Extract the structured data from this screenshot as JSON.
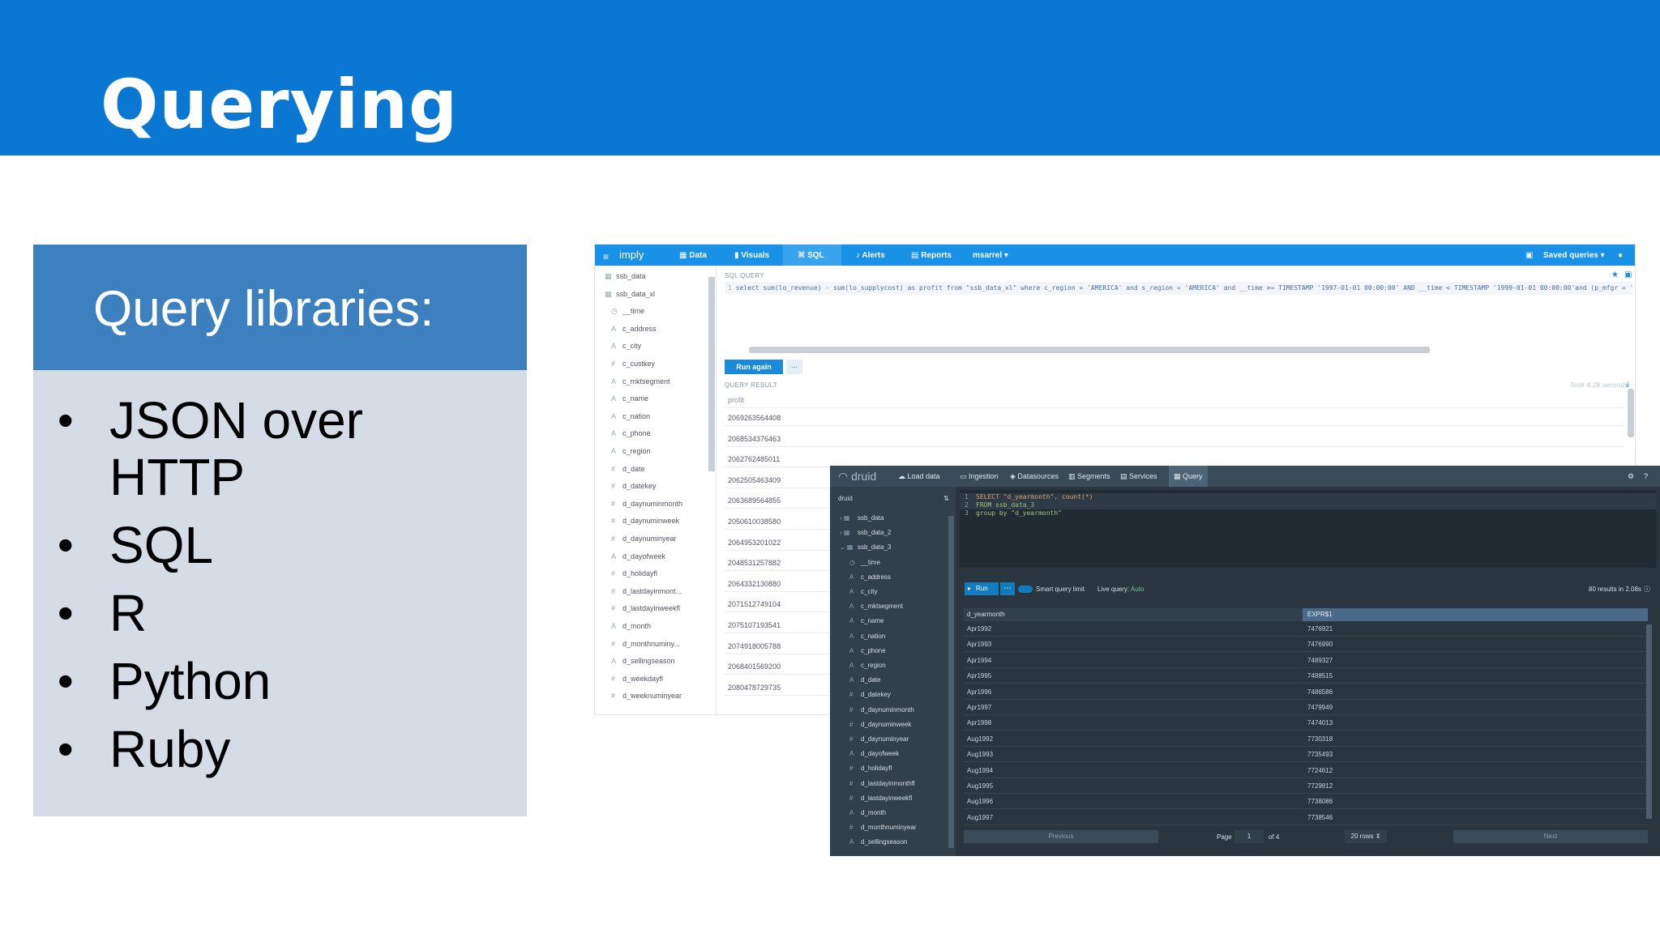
{
  "slide": {
    "title": "Querying",
    "libraries_heading": "Query libraries:",
    "libraries": [
      "JSON over HTTP",
      "SQL",
      "R",
      "Python",
      "Ruby"
    ]
  },
  "imply": {
    "brand": "imply",
    "nav": [
      "Data",
      "Visuals",
      "SQL",
      "Alerts",
      "Reports",
      "msarrel"
    ],
    "saved_queries": "Saved queries",
    "sidebar": [
      {
        "icon": "table-icon",
        "label": "ssb_data"
      },
      {
        "icon": "table-icon",
        "label": "ssb_data_xl"
      },
      {
        "icon": "clock-icon",
        "label": "__time"
      },
      {
        "icon": "string-icon",
        "label": "c_address"
      },
      {
        "icon": "string-icon",
        "label": "c_city"
      },
      {
        "icon": "number-icon",
        "label": "c_custkey"
      },
      {
        "icon": "string-icon",
        "label": "c_mktsegment"
      },
      {
        "icon": "string-icon",
        "label": "c_name"
      },
      {
        "icon": "string-icon",
        "label": "c_nation"
      },
      {
        "icon": "string-icon",
        "label": "c_phone"
      },
      {
        "icon": "string-icon",
        "label": "c_region"
      },
      {
        "icon": "number-icon",
        "label": "d_date"
      },
      {
        "icon": "number-icon",
        "label": "d_datekey"
      },
      {
        "icon": "number-icon",
        "label": "d_daynuminmonth"
      },
      {
        "icon": "number-icon",
        "label": "d_daynuminweek"
      },
      {
        "icon": "number-icon",
        "label": "d_daynuminyear"
      },
      {
        "icon": "string-icon",
        "label": "d_dayofweek"
      },
      {
        "icon": "number-icon",
        "label": "d_holidayfl"
      },
      {
        "icon": "number-icon",
        "label": "d_lastdayinmont..."
      },
      {
        "icon": "number-icon",
        "label": "d_lastdayinweekfl"
      },
      {
        "icon": "string-icon",
        "label": "d_month"
      },
      {
        "icon": "number-icon",
        "label": "d_monthnuminy..."
      },
      {
        "icon": "string-icon",
        "label": "d_sellingseason"
      },
      {
        "icon": "number-icon",
        "label": "d_weekdayfl"
      },
      {
        "icon": "number-icon",
        "label": "d_weeknuminyear"
      }
    ],
    "sql_query_label": "SQL QUERY",
    "query_text": "select sum(lo_revenue) - sum(lo_supplycost) as profit from \"ssb_data_xl\" where c_region = 'AMERICA' and s_region = 'AMERICA' and __time >= TIMESTAMP '1997-01-01 00:00:00' AND __time < TIMESTAMP '1999-01-01 00:00:00'and (p_mfgr = 'MFGR#1' or p_mfgr =",
    "run_again": "Run again",
    "more": "...",
    "query_result_label": "QUERY RESULT",
    "took": "Took 4.28 seconds",
    "result_column": "profit",
    "results": [
      "2069263564408",
      "2068534376463",
      "2062762485011",
      "2062505463409",
      "2063689564855",
      "2050610038580",
      "2064953201022",
      "2048531257882",
      "2064332130880",
      "2071512749104",
      "2075107193541",
      "2074918005788",
      "2068401569200",
      "2080478729735"
    ]
  },
  "druid": {
    "brand": "druid",
    "nav": [
      "Load data",
      "Ingestion",
      "Datasources",
      "Segments",
      "Services",
      "Query"
    ],
    "sidebar_root": "druid",
    "sidebar": [
      {
        "icon": "table-icon",
        "label": "ssb_data"
      },
      {
        "icon": "table-icon",
        "label": "ssb_data_2"
      },
      {
        "icon": "table-icon",
        "label": "ssb_data_3"
      },
      {
        "icon": "clock-icon",
        "label": "__time"
      },
      {
        "icon": "string-icon",
        "label": "c_address"
      },
      {
        "icon": "string-icon",
        "label": "c_city"
      },
      {
        "icon": "string-icon",
        "label": "c_mktsegment"
      },
      {
        "icon": "string-icon",
        "label": "c_name"
      },
      {
        "icon": "string-icon",
        "label": "c_nation"
      },
      {
        "icon": "string-icon",
        "label": "c_phone"
      },
      {
        "icon": "string-icon",
        "label": "c_region"
      },
      {
        "icon": "string-icon",
        "label": "d_date"
      },
      {
        "icon": "number-icon",
        "label": "d_datekey"
      },
      {
        "icon": "number-icon",
        "label": "d_daynuminmonth"
      },
      {
        "icon": "number-icon",
        "label": "d_daynuminweek"
      },
      {
        "icon": "number-icon",
        "label": "d_daynuminyear"
      },
      {
        "icon": "string-icon",
        "label": "d_dayofweek"
      },
      {
        "icon": "number-icon",
        "label": "d_holidayfl"
      },
      {
        "icon": "number-icon",
        "label": "d_lastdayinmonthfl"
      },
      {
        "icon": "number-icon",
        "label": "d_lastdayinweekfl"
      },
      {
        "icon": "string-icon",
        "label": "d_month"
      },
      {
        "icon": "number-icon",
        "label": "d_monthnuminyear"
      },
      {
        "icon": "string-icon",
        "label": "d_sellingseason"
      }
    ],
    "query_lines": [
      "SELECT \"d_yearmonth\", count(*)",
      "FROM ssb_data_3",
      "group by \"d_yearmonth\""
    ],
    "run": "Run",
    "smart_limit": "Smart query limit",
    "live_query_label": "Live query:",
    "live_query_value": "Auto",
    "results_info": "80 results in 2.08s",
    "columns": [
      "d_yearmonth",
      "EXPR$1"
    ],
    "rows": [
      [
        "Apr1992",
        "7476921"
      ],
      [
        "Apr1993",
        "7476990"
      ],
      [
        "Apr1994",
        "7489327"
      ],
      [
        "Apr1995",
        "7488515"
      ],
      [
        "Apr1996",
        "7486586"
      ],
      [
        "Apr1997",
        "7479949"
      ],
      [
        "Apr1998",
        "7474013"
      ],
      [
        "Aug1992",
        "7730318"
      ],
      [
        "Aug1993",
        "7735493"
      ],
      [
        "Aug1994",
        "7724612"
      ],
      [
        "Aug1995",
        "7729812"
      ],
      [
        "Aug1996",
        "7738086"
      ],
      [
        "Aug1997",
        "7738546"
      ]
    ],
    "previous": "Previous",
    "page_label": "Page",
    "page_value": "1",
    "of_pages": "of 4",
    "rows_per_page": "20 rows",
    "next": "Next"
  }
}
